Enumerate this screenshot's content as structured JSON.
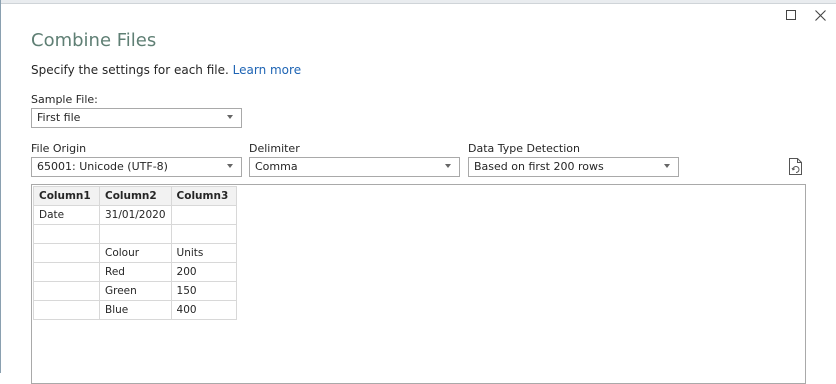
{
  "window": {
    "maximize_icon": "square-icon",
    "close_icon": "close-icon"
  },
  "dialog": {
    "title": "Combine Files",
    "instruction": "Specify the settings for each file.",
    "learn_more": "Learn more"
  },
  "sample_file": {
    "label": "Sample File:",
    "value": "First file"
  },
  "file_origin": {
    "label": "File Origin",
    "value": "65001: Unicode (UTF-8)"
  },
  "delimiter": {
    "label": "Delimiter",
    "value": "Comma"
  },
  "data_type_detection": {
    "label": "Data Type Detection",
    "value": "Based on first 200 rows"
  },
  "preview": {
    "columns": [
      "Column1",
      "Column2",
      "Column3"
    ],
    "rows": [
      [
        "Date",
        "31/01/2020",
        ""
      ],
      [
        "",
        "",
        ""
      ],
      [
        "",
        "Colour",
        "Units"
      ],
      [
        "",
        "Red",
        "200"
      ],
      [
        "",
        "Green",
        "150"
      ],
      [
        "",
        "Blue",
        "400"
      ]
    ]
  }
}
